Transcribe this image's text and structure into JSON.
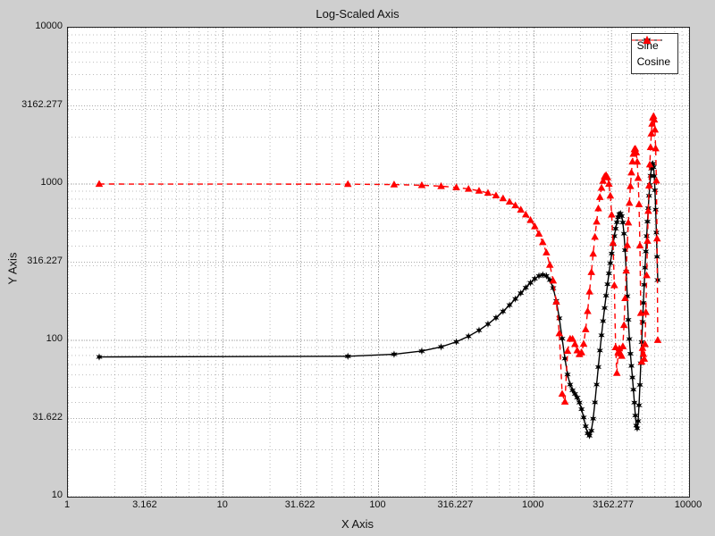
{
  "chart_data": {
    "type": "line",
    "title": "Log-Scaled Axis",
    "xlabel": "X Axis",
    "ylabel": "Y Axis",
    "xscale": "log",
    "yscale": "log",
    "xlim": [
      1,
      10000
    ],
    "ylim": [
      10,
      10000
    ],
    "xticks": [
      1,
      3.162,
      10,
      31.622,
      100,
      316.227,
      1000,
      3162.277,
      10000
    ],
    "xtick_labels": [
      "1",
      "3.162",
      "10",
      "31.622",
      "100",
      "316.227",
      "1000",
      "3162.277",
      "10000"
    ],
    "yticks": [
      10,
      31.622,
      100,
      316.227,
      1000,
      3162.277,
      10000
    ],
    "ytick_labels": [
      "10",
      "31.622",
      "100",
      "316.227",
      "1000",
      "3162.277",
      "10000"
    ],
    "legend_position": "top-right",
    "x": [
      1.59,
      63.5,
      126,
      190,
      253,
      317,
      380,
      444,
      507,
      571,
      634,
      698,
      761,
      825,
      888,
      952,
      1015,
      1079,
      1142,
      1206,
      1269,
      1333,
      1396,
      1460,
      1523,
      1587,
      1650,
      1714,
      1777,
      1841,
      1904,
      1968,
      2031,
      2095,
      2158,
      2222,
      2285,
      2349,
      2412,
      2476,
      2539,
      2603,
      2666,
      2730,
      2793,
      2857,
      2920,
      2984,
      3047,
      3111,
      3174,
      3238,
      3301,
      3365,
      3428,
      3492,
      3555,
      3618,
      3682,
      3745,
      3809,
      3872,
      3936,
      3999,
      4063,
      4126,
      4190,
      4253,
      4317,
      4380,
      4444,
      4507,
      4571,
      4634,
      4698,
      4761,
      4825,
      4888,
      4952,
      5015,
      5079,
      5142,
      5206,
      5269,
      5333,
      5396,
      5460,
      5523,
      5587,
      5650,
      5714,
      5777,
      5840,
      5904,
      5967,
      6031,
      6094,
      6158,
      6221,
      6285
    ],
    "series": [
      {
        "name": "Sine",
        "marker": "star6",
        "color": "#000000",
        "linestyle": "solid",
        "values": [
          78.34,
          79.13,
          81.5,
          85.43,
          90.88,
          97.82,
          106.2,
          116.0,
          127.1,
          139.5,
          153.2,
          168.1,
          184.0,
          200.6,
          217.4,
          233.5,
          247.7,
          258.2,
          262.7,
          258.5,
          243.3,
          216.0,
          178.9,
          138.5,
          102.6,
          76.46,
          60.52,
          52.14,
          47.96,
          45.44,
          43.03,
          40.02,
          36.29,
          32.13,
          28.22,
          25.41,
          24.56,
          26.43,
          31.54,
          40.11,
          52.14,
          67.5,
          86.08,
          107.8,
          132.8,
          161.1,
          193.0,
          228.6,
          268.1,
          311.7,
          359.3,
          410.5,
          464.2,
          518.3,
          569.4,
          612.5,
          641.1,
          647.3,
          623.9,
          567.4,
          481.1,
          377.3,
          274.8,
          191.6,
          135.4,
          102.0,
          82.14,
          68.68,
          57.88,
          48.38,
          39.98,
          33.06,
          28.53,
          27.37,
          30.45,
          38.43,
          51.87,
          71.3,
          97.4,
          131.1,
          173.7,
          226.6,
          291.6,
          370.4,
          464.5,
          574.9,
          701.2,
          840.7,
          987.3,
          1130,
          1253,
          1334,
          1349,
          1280,
          1125,
          912.7,
          685.9,
          489.2,
          342.3,
          243.0
        ]
      },
      {
        "name": "Cosine",
        "marker": "triangle",
        "color": "#ff0000",
        "linestyle": "dashed",
        "values": [
          1000,
          998.0,
          992.1,
          982.3,
          968.6,
          951.1,
          929.8,
          904.8,
          876.3,
          844.3,
          809.0,
          770.5,
          729.0,
          684.5,
          637.3,
          587.5,
          535.2,
          480.5,
          423.6,
          364.5,
          303.6,
          240.8,
          176.5,
          110.8,
          45.48,
          40.48,
          85.36,
          102.3,
          102.1,
          94.62,
          86.17,
          81.5,
          83.67,
          94.98,
          117.6,
          153.6,
          204.9,
          272.7,
          357.7,
          458.9,
          573.7,
          697.7,
          824.4,
          944.4,
          1046,
          1116,
          1139,
          1103,
          1002,
          841.2,
          636.6,
          419.5,
          225.0,
          90.19,
          61.8,
          83.74,
          88.65,
          82.22,
          79.46,
          91.51,
          125.1,
          186.0,
          278.8,
          405.9,
          566.7,
          756.7,
          967.2,
          1184,
          1389,
          1558,
          1665,
          1682,
          1591,
          1388,
          1091,
          742.0,
          403.4,
          149.4,
          72.97,
          89.37,
          81.76,
          76.13,
          94.44,
          151.3,
          260.5,
          432.3,
          671.5,
          975.4,
          1332,
          1718,
          2099,
          2429,
          2654,
          2718,
          2580,
          2226,
          1689,
          1051,
          447.2,
          100.4
        ]
      }
    ]
  }
}
